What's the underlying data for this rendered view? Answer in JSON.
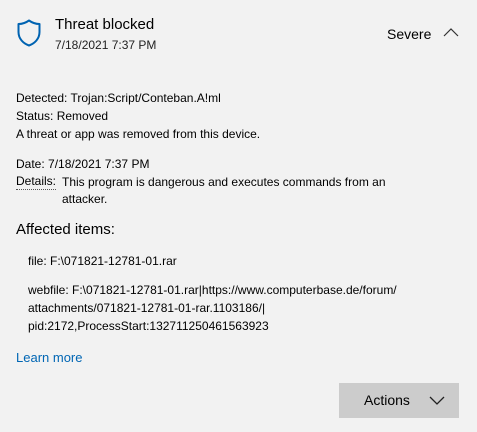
{
  "header": {
    "title": "Threat blocked",
    "timestamp": "7/18/2021 7:37 PM",
    "severity": "Severe",
    "shield_icon": "shield-icon",
    "collapse_icon": "chevron-up-icon"
  },
  "detection": {
    "detected_label": "Detected:",
    "detected_value": "Trojan:Script/Conteban.A!ml",
    "status_label": "Status:",
    "status_value": "Removed",
    "status_description": "A threat or app was removed from this device.",
    "date_label": "Date:",
    "date_value": "7/18/2021 7:37 PM",
    "details_label": "Details:",
    "details_value": "This program is dangerous and executes commands from an attacker."
  },
  "affected": {
    "heading": "Affected items:",
    "file_line": "file: F:\\071821-12781-01.rar",
    "webfile_lines": [
      "webfile: F:\\071821-12781-01.rar|https://www.computerbase.de/forum/",
      "attachments/071821-12781-01-rar.1103186/|",
      "pid:2172,ProcessStart:132711250461563923"
    ]
  },
  "links": {
    "learn_more": "Learn more"
  },
  "actions": {
    "label": "Actions",
    "icon": "chevron-down-icon"
  },
  "colors": {
    "background": "#f2f2f2",
    "link": "#0066b4",
    "shield": "#0063b1",
    "button": "#cccccc"
  }
}
